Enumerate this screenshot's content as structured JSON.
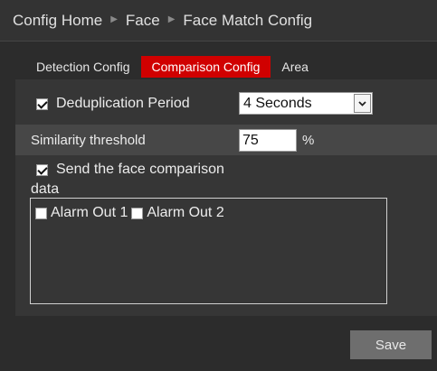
{
  "breadcrumb": {
    "items": [
      "Config Home",
      "Face",
      "Face Match Config"
    ],
    "separator": "▶"
  },
  "tabs": [
    {
      "label": "Detection Config",
      "active": false
    },
    {
      "label": "Comparison Config",
      "active": true
    },
    {
      "label": "Area",
      "active": false
    }
  ],
  "dedup": {
    "label": "Deduplication Period",
    "checked": true,
    "value": "4 Seconds"
  },
  "similarity": {
    "label": "Similarity threshold",
    "value": "75",
    "unit": "%"
  },
  "send": {
    "label_line1": "Send the face comparison",
    "label_line2": "data",
    "checked": true
  },
  "alarms": [
    {
      "label": "Alarm Out 1",
      "checked": false
    },
    {
      "label": "Alarm Out 2",
      "checked": false
    }
  ],
  "actions": {
    "save_label": "Save"
  },
  "colors": {
    "accent": "#d00000",
    "background": "#2c2c2c",
    "panel": "#363636"
  }
}
